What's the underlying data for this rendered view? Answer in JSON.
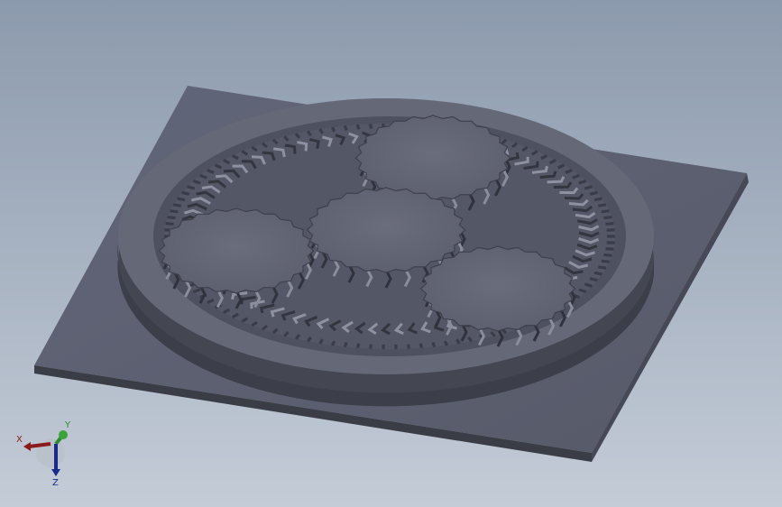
{
  "viewport": {
    "background_top": "#8c9aad",
    "background_bottom": "#c4ccd7"
  },
  "model": {
    "description_type": "planetary gear assembly",
    "planet_gear_count": 4,
    "colors": {
      "plate_top": "#5d6170",
      "plate_edge": "#40434e",
      "disc_top": "#6b6e7c",
      "disc_side": "#4a4d58",
      "gear_face": "#646775",
      "tooth_dark": "#3b3e49",
      "tooth_light": "#8a8d9a"
    }
  },
  "triad": {
    "x_label": "X",
    "y_label": "Y",
    "z_label": "Z",
    "x_color": "#8b1a1a",
    "y_color": "#2e8b2e",
    "z_color": "#1a2a8b"
  }
}
